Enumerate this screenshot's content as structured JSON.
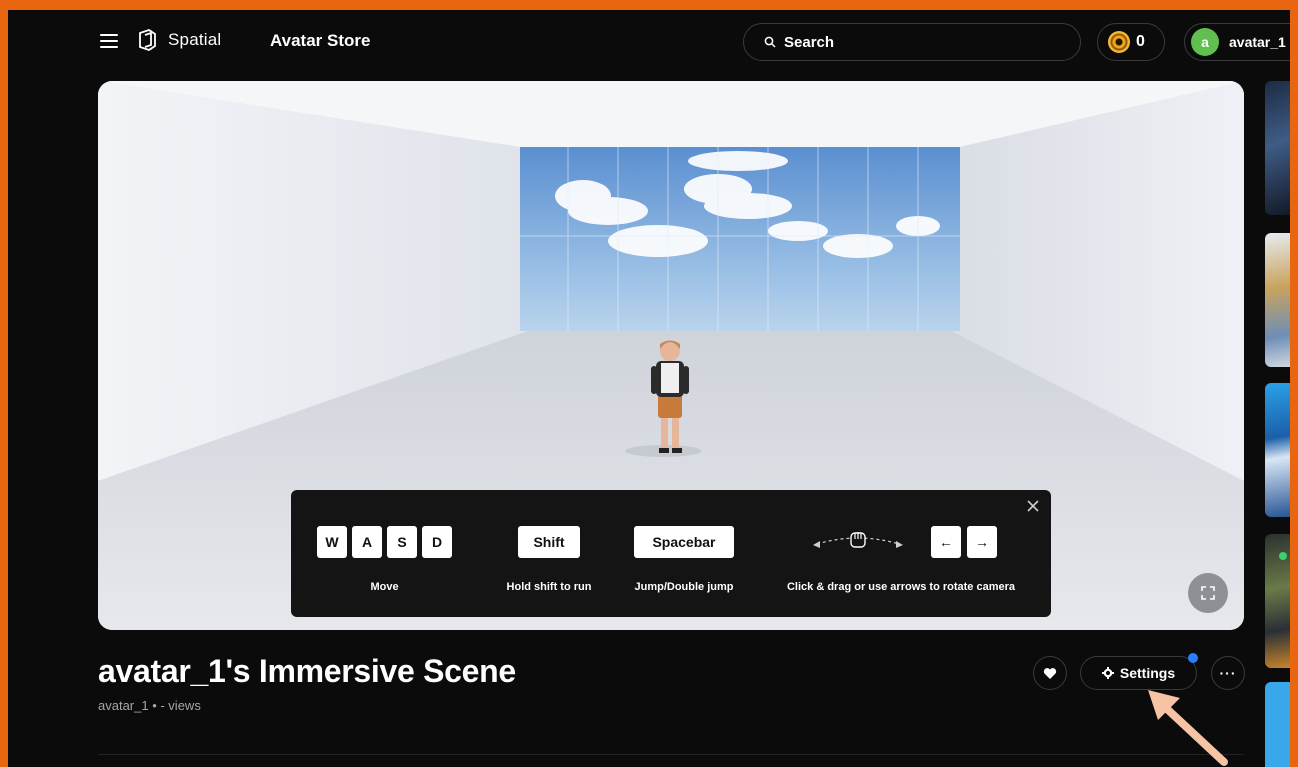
{
  "header": {
    "brand": "Spatial",
    "store_link": "Avatar Store",
    "search_placeholder": "Search",
    "coins": "0",
    "user_initial": "a",
    "username": "avatar_1"
  },
  "controls": {
    "keys_move": [
      "W",
      "A",
      "S",
      "D"
    ],
    "move_label": "Move",
    "shift_key": "Shift",
    "shift_label": "Hold shift to run",
    "space_key": "Spacebar",
    "space_label": "Jump/Double jump",
    "camera_label": "Click & drag or use arrows to rotate camera",
    "arrow_left": "←",
    "arrow_right": "→"
  },
  "space": {
    "title": "avatar_1's Immersive Scene",
    "meta": "avatar_1 • - views"
  },
  "actions": {
    "settings_label": "Settings",
    "more_label": "···"
  },
  "colors": {
    "frame": "#e8660f",
    "background": "#0b0b0b",
    "avatar_bg": "#5fbf4f",
    "notification": "#2b7cff",
    "annotation_arrow": "#f6c3a5"
  }
}
